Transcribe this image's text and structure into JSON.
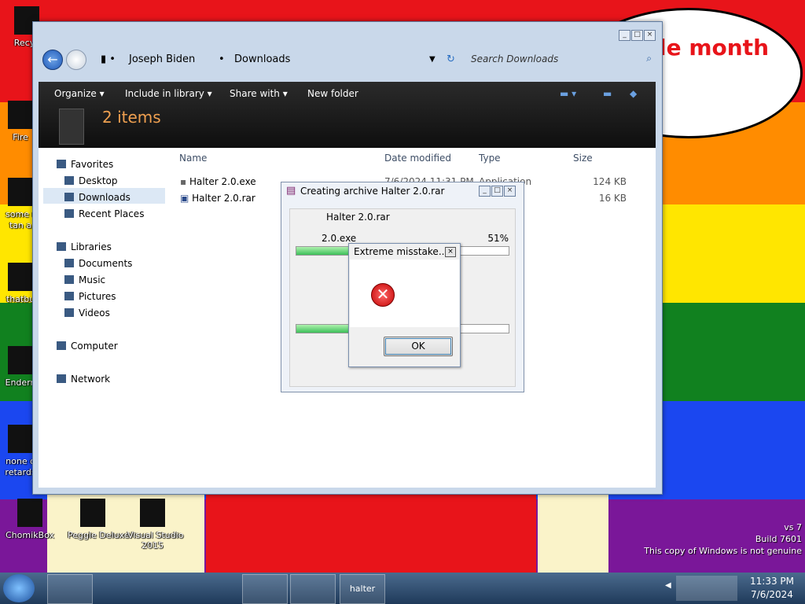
{
  "wallpaper": {
    "speech_text": "le month"
  },
  "desktop_icons": [
    {
      "label": "Recyc"
    },
    {
      "label": "Fire"
    },
    {
      "label": "some r\ntan a"
    },
    {
      "label": "thatbu"
    },
    {
      "label": "Endern"
    },
    {
      "label": "none o\nretards"
    },
    {
      "label": "ChomikBox"
    },
    {
      "label": "Peggle Deluxe"
    },
    {
      "label": "Visual Studio\n2015"
    }
  ],
  "explorer": {
    "breadcrumb": [
      "Joseph Biden",
      "Downloads"
    ],
    "search_placeholder": "Search Downloads",
    "toolbar": {
      "organize": "Organize",
      "include_in_library": "Include in library",
      "share_with": "Share with",
      "new_folder": "New folder"
    },
    "item_count": "2 items",
    "nav": {
      "favorites": "Favorites",
      "desktop": "Desktop",
      "downloads": "Downloads",
      "recent_places": "Recent Places",
      "libraries": "Libraries",
      "documents": "Documents",
      "music": "Music",
      "pictures": "Pictures",
      "videos": "Videos",
      "computer": "Computer",
      "network": "Network"
    },
    "columns": {
      "name": "Name",
      "date": "Date modified",
      "type": "Type",
      "size": "Size"
    },
    "files": [
      {
        "name": "Halter 2.0.exe",
        "date": "7/6/2024 11:31 PM",
        "type": "Application",
        "size": "124 KB"
      },
      {
        "name": "Halter 2.0.rar",
        "date": "",
        "type": "",
        "size": "16 KB"
      }
    ]
  },
  "rar_dialog": {
    "title": "Creating archive Halter 2.0.rar",
    "archive": "Halter 2.0.rar",
    "current_file": "2.0.exe",
    "percent": "51%",
    "progress_fraction": 0.51
  },
  "error_dialog": {
    "title": "Extreme misstake...",
    "ok": "OK"
  },
  "taskbar": {
    "halter_label": "halter",
    "time": "11:33 PM",
    "date": "7/6/2024"
  },
  "watermark": {
    "line1": "vs 7",
    "line2": "Build 7601",
    "line3": "This copy of Windows is not genuine"
  }
}
